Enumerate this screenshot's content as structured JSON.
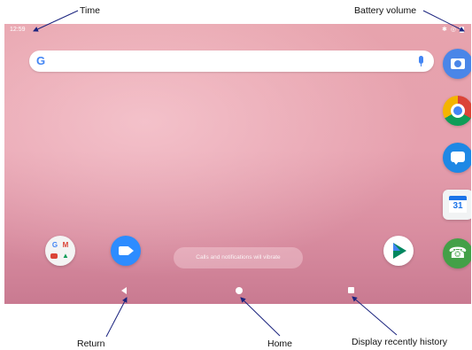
{
  "callouts": {
    "time": "Time",
    "battery": "Battery volume",
    "return": "Return",
    "home": "Home",
    "recents": "Display recently history"
  },
  "status_bar": {
    "time": "12:59"
  },
  "search": {
    "logo": "G",
    "mic_icon": "mic-icon"
  },
  "right_dock": [
    {
      "name": "camera",
      "icon": "camera-icon"
    },
    {
      "name": "chrome",
      "icon": "chrome-icon"
    },
    {
      "name": "messages",
      "icon": "messages-icon"
    },
    {
      "name": "calendar",
      "icon": "calendar-icon",
      "day": "31"
    },
    {
      "name": "phone",
      "icon": "phone-icon"
    }
  ],
  "home_apps": [
    {
      "name": "google-folder",
      "icon": "google-folder-icon"
    },
    {
      "name": "zoom",
      "icon": "video-camera-icon"
    },
    {
      "name": "play-store",
      "icon": "play-store-icon"
    }
  ],
  "toast": "Calls and notifications will vibrate",
  "colors": {
    "wallpaper_top": "#e7a3ad",
    "wallpaper_bottom": "#c97a91",
    "accent_blue": "#4285F4"
  }
}
